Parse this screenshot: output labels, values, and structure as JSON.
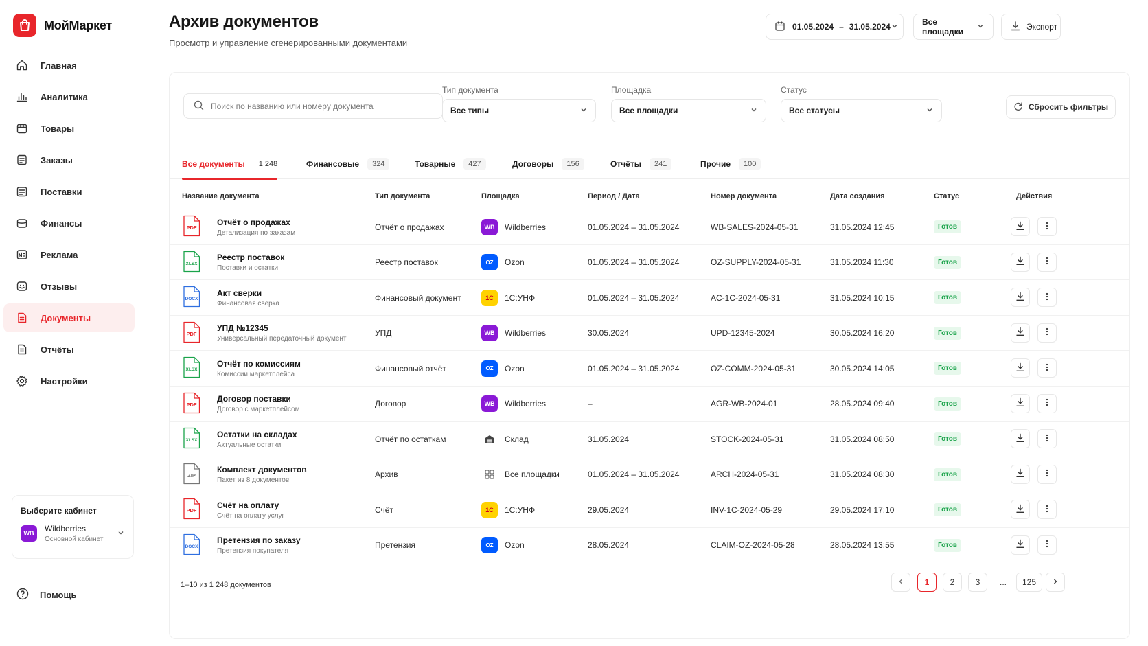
{
  "brand": {
    "name": "МойМаркет"
  },
  "colors": {
    "accent": "#e8262b",
    "wb": "#8a19d6",
    "ozon": "#005bff",
    "c1": "#ffd200",
    "status_ok": "#1aa34a"
  },
  "sidebar": {
    "items": [
      {
        "label": "Главная",
        "icon": "home-icon"
      },
      {
        "label": "Аналитика",
        "icon": "chart-icon"
      },
      {
        "label": "Товары",
        "icon": "box-icon"
      },
      {
        "label": "Заказы",
        "icon": "orders-icon"
      },
      {
        "label": "Поставки",
        "icon": "supply-icon"
      },
      {
        "label": "Финансы",
        "icon": "wallet-icon"
      },
      {
        "label": "Реклама",
        "icon": "ads-icon"
      },
      {
        "label": "Отзывы",
        "icon": "reviews-icon"
      },
      {
        "label": "Документы",
        "icon": "document-icon",
        "active": true
      },
      {
        "label": "Отчёты",
        "icon": "report-icon"
      },
      {
        "label": "Настройки",
        "icon": "gear-icon"
      }
    ],
    "cabinet": {
      "title": "Выберите кабинет",
      "badge": "WB",
      "name": "Wildberries",
      "sub": "Основной кабинет"
    },
    "help": "Помощь"
  },
  "header": {
    "title": "Архив документов",
    "subtitle": "Просмотр и управление сгенерированными документами",
    "date_from": "01.05.2024",
    "date_sep": "–",
    "date_to": "31.05.2024",
    "platform_select": "Все площадки",
    "export": "Экспорт"
  },
  "filters": {
    "search_placeholder": "Поиск по названию или номеру документа",
    "type": {
      "label": "Тип документа",
      "value": "Все типы"
    },
    "platform": {
      "label": "Площадка",
      "value": "Все площадки"
    },
    "status": {
      "label": "Статус",
      "value": "Все статусы"
    },
    "reset": "Сбросить фильтры"
  },
  "tabs": [
    {
      "label": "Все документы",
      "count": "1 248",
      "active": true
    },
    {
      "label": "Финансовые",
      "count": "324"
    },
    {
      "label": "Товарные",
      "count": "427"
    },
    {
      "label": "Договоры",
      "count": "156"
    },
    {
      "label": "Отчёты",
      "count": "241"
    },
    {
      "label": "Прочие",
      "count": "100"
    }
  ],
  "table": {
    "columns": [
      "Название документа",
      "Тип документа",
      "Площадка",
      "Период / Дата",
      "Номер документа",
      "Дата создания",
      "Статус",
      "Действия"
    ],
    "rows": [
      {
        "ext": "PDF",
        "title": "Отчёт о продажах",
        "sub": "Детализация по заказам",
        "type": "Отчёт о продажах",
        "platform": "Wildberries",
        "badge": "WB",
        "period": "01.05.2024 – 31.05.2024",
        "number": "WB-SALES-2024-05-31",
        "created": "31.05.2024 12:45",
        "status": "Готов"
      },
      {
        "ext": "XLSX",
        "title": "Реестр поставок",
        "sub": "Поставки и остатки",
        "type": "Реестр поставок",
        "platform": "Ozon",
        "badge": "OZ",
        "period": "01.05.2024 – 31.05.2024",
        "number": "OZ-SUPPLY-2024-05-31",
        "created": "31.05.2024 11:30",
        "status": "Готов"
      },
      {
        "ext": "DOCX",
        "title": "Акт сверки",
        "sub": "Финансовая сверка",
        "type": "Финансовый документ",
        "platform": "1С:УНФ",
        "badge": "1C",
        "period": "01.05.2024 – 31.05.2024",
        "number": "AC-1C-2024-05-31",
        "created": "31.05.2024 10:15",
        "status": "Готов"
      },
      {
        "ext": "PDF",
        "title": "УПД №12345",
        "sub": "Универсальный передаточный документ",
        "type": "УПД",
        "platform": "Wildberries",
        "badge": "WB",
        "period": "30.05.2024",
        "number": "UPD-12345-2024",
        "created": "30.05.2024 16:20",
        "status": "Готов"
      },
      {
        "ext": "XLSX",
        "title": "Отчёт по комиссиям",
        "sub": "Комиссии маркетплейса",
        "type": "Финансовый отчёт",
        "platform": "Ozon",
        "badge": "OZ",
        "period": "01.05.2024 – 31.05.2024",
        "number": "OZ-COMM-2024-05-31",
        "created": "30.05.2024 14:05",
        "status": "Готов"
      },
      {
        "ext": "PDF",
        "title": "Договор поставки",
        "sub": "Договор с маркетплейсом",
        "type": "Договор",
        "platform": "Wildberries",
        "badge": "WB",
        "period": "–",
        "number": "AGR-WB-2024-01",
        "created": "28.05.2024 09:40",
        "status": "Готов"
      },
      {
        "ext": "XLSX",
        "title": "Остатки на складах",
        "sub": "Актуальные остатки",
        "type": "Отчёт по остаткам",
        "platform": "Склад",
        "badge": "WH",
        "period": "31.05.2024",
        "number": "STOCK-2024-05-31",
        "created": "31.05.2024 08:50",
        "status": "Готов"
      },
      {
        "ext": "ZIP",
        "title": "Комплект документов",
        "sub": "Пакет из 8 документов",
        "type": "Архив",
        "platform": "Все площадки",
        "badge": "ALL",
        "period": "01.05.2024 – 31.05.2024",
        "number": "ARCH-2024-05-31",
        "created": "31.05.2024 08:30",
        "status": "Готов"
      },
      {
        "ext": "PDF",
        "title": "Счёт на оплату",
        "sub": "Счёт на оплату услуг",
        "type": "Счёт",
        "platform": "1С:УНФ",
        "badge": "1C",
        "period": "29.05.2024",
        "number": "INV-1C-2024-05-29",
        "created": "29.05.2024 17:10",
        "status": "Готов"
      },
      {
        "ext": "DOCX",
        "title": "Претензия по заказу",
        "sub": "Претензия покупателя",
        "type": "Претензия",
        "platform": "Ozon",
        "badge": "OZ",
        "period": "28.05.2024",
        "number": "CLAIM-OZ-2024-05-28",
        "created": "28.05.2024 13:55",
        "status": "Готов"
      }
    ]
  },
  "pagination": {
    "range": "1–10 из 1 248 документов",
    "pages": [
      "1",
      "2",
      "3",
      "...",
      "125"
    ],
    "current": "1"
  }
}
